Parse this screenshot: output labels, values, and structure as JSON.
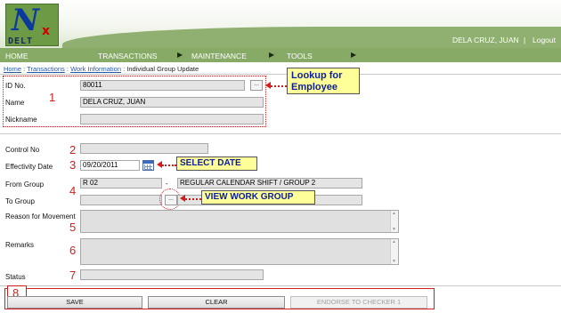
{
  "header": {
    "logo_letter": "N",
    "logo_sub": "x",
    "logo_bars": "DELT",
    "user_name": "DELA CRUZ, JUAN",
    "separator": "|",
    "logout_label": "Logout"
  },
  "menu": {
    "home": "HOME",
    "transactions": "TRANSACTIONS",
    "maintenance": "MAINTENANCE",
    "tools": "TOOLS",
    "arrow": "▶"
  },
  "breadcrumb": {
    "home": "Home",
    "transactions": "Transactions",
    "work_information": "Work Information",
    "current": "Individual Group Update",
    "sep": " : "
  },
  "form": {
    "id_no_label": "ID No.",
    "id_no_value": "80011",
    "name_label": "Name",
    "name_value": "DELA CRUZ, JUAN",
    "nickname_label": "Nickname",
    "nickname_value": "",
    "control_no_label": "Control No",
    "control_no_value": "",
    "effectivity_label": "Effectivity Date",
    "effectivity_value": "09/20/2011",
    "from_group_label": "From Group",
    "from_group_code": "R 02",
    "from_group_dash": "-",
    "from_group_desc": "REGULAR CALENDAR SHIFT / GROUP 2",
    "to_group_label": "To Group",
    "to_group_value": "",
    "reason_label": "Reason for Movement",
    "remarks_label": "Remarks",
    "status_label": "Status",
    "status_value": "",
    "lookup_button": "...",
    "work_group_button": "..."
  },
  "annotations": {
    "n1": "1",
    "n2": "2",
    "n3": "3",
    "n4": "4",
    "n5": "5",
    "n6": "6",
    "n7": "7",
    "n8": "8",
    "lookup_line1": "Lookup for",
    "lookup_line2": "Employee",
    "select_date": "SELECT DATE",
    "view_work_group": "VIEW WORK GROUP"
  },
  "buttons": {
    "save": "SAVE",
    "clear": "CLEAR",
    "endorse": "ENDORSE TO CHECKER 1"
  },
  "colors": {
    "menu_green": "#87ab67",
    "annotation_red": "#d21d1d",
    "callout_yellow": "#ffff99",
    "callout_text": "#0c1e9c"
  }
}
